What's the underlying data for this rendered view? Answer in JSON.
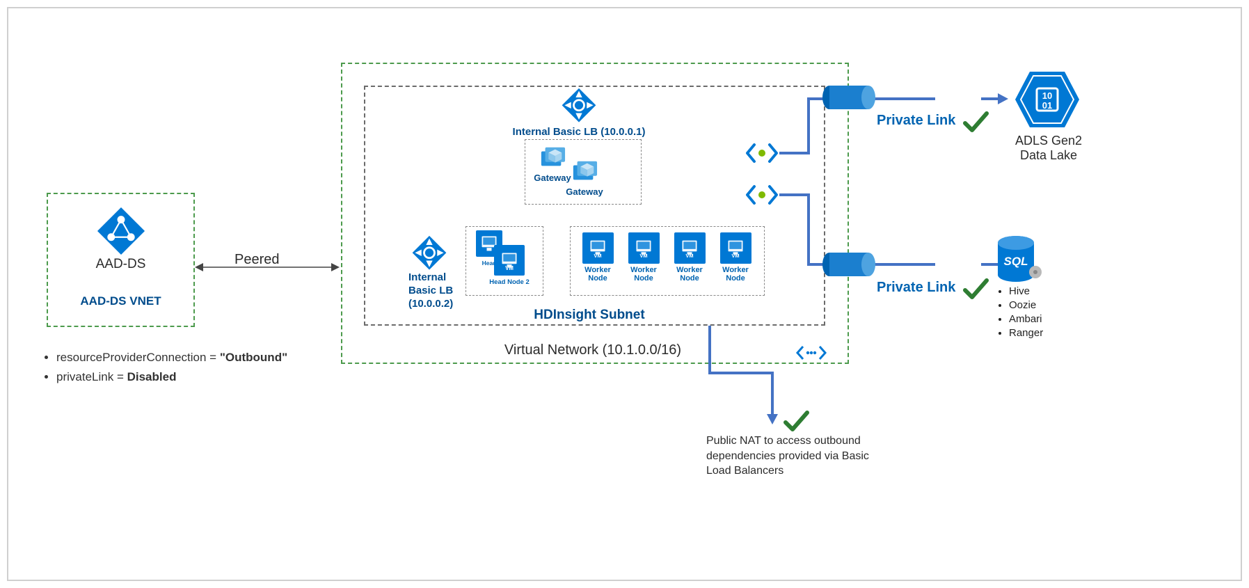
{
  "aad": {
    "title": "AAD-DS",
    "vnet": "AAD-DS VNET"
  },
  "peered": "Peered",
  "vnet_label": "Virtual Network (10.1.0.0/16)",
  "subnet_label": "HDInsight Subnet",
  "lb1": "Internal Basic LB (10.0.0.1)",
  "lb2_a": "Internal",
  "lb2_b": "Basic LB",
  "lb2_c": "(10.0.0.2)",
  "gw1": "Gateway",
  "gw2": "Gateway",
  "head1": "Head",
  "head2": "Head Node 2",
  "worker": "Worker Node",
  "vm_tag": "VM",
  "pl1": "Private Link",
  "pl2": "Private Link",
  "adls_a": "ADLS Gen2",
  "adls_b": "Data Lake",
  "sql": "SQL",
  "sql_list": [
    "Hive",
    "Oozie",
    "Ambari",
    "Ranger"
  ],
  "nat_note": "Public NAT to access outbound dependencies provided via Basic Load Balancers",
  "cfg": {
    "rp_key": "resourceProviderConnection",
    "rp_val": "\"Outbound\"",
    "pl_key": "privateLink",
    "pl_val": "Disabled"
  }
}
